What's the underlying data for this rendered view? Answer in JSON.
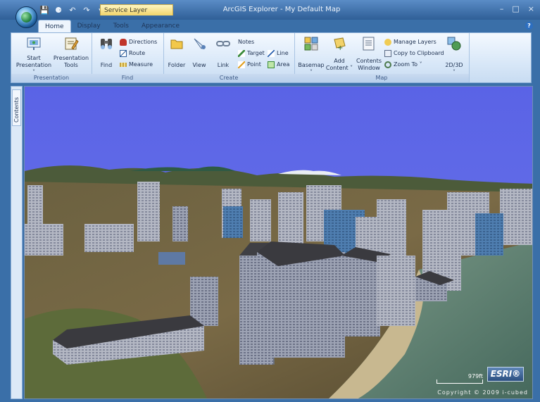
{
  "titlebar": {
    "title": "ArcGIS Explorer - My Default Map",
    "contextual_tab": "Service Layer",
    "qat_icons": [
      "save-icon",
      "binoculars-icon",
      "undo-icon",
      "redo-icon",
      "dropdown-icon"
    ],
    "controls": [
      "–",
      "□",
      "×"
    ]
  },
  "tabs": [
    "Home",
    "Display",
    "Tools",
    "Appearance"
  ],
  "help": "?",
  "ribbon": {
    "presentation": {
      "label": "Presentation",
      "start_l1": "Start",
      "start_l2": "Presentation ˅",
      "tools_l1": "Presentation",
      "tools_l2": "Tools"
    },
    "find": {
      "label": "Find",
      "find": "Find",
      "directions": "Directions",
      "route": "Route",
      "measure": "Measure"
    },
    "create": {
      "label": "Create",
      "folder": "Folder",
      "view": "View",
      "link": "Link",
      "notes": "Notes",
      "target": "Target",
      "line": "Line",
      "point": "Point",
      "area": "Area"
    },
    "map": {
      "label": "Map",
      "basemap": "Basemap",
      "add_l1": "Add",
      "add_l2": "Content ˅",
      "contents_l1": "Contents",
      "contents_l2": "Window",
      "manage_layers": "Manage Layers",
      "copy_clipboard": "Copy to Clipboard",
      "zoom_to": "Zoom To ˅",
      "toggle_3d": "2D/3D"
    }
  },
  "sidebar": {
    "contents_tab": "Contents"
  },
  "map": {
    "scale": "979ft",
    "logo": "ESRI®",
    "copyright": "Copyright © 2009 i-cubed",
    "sky_color": "#5c64e6"
  }
}
